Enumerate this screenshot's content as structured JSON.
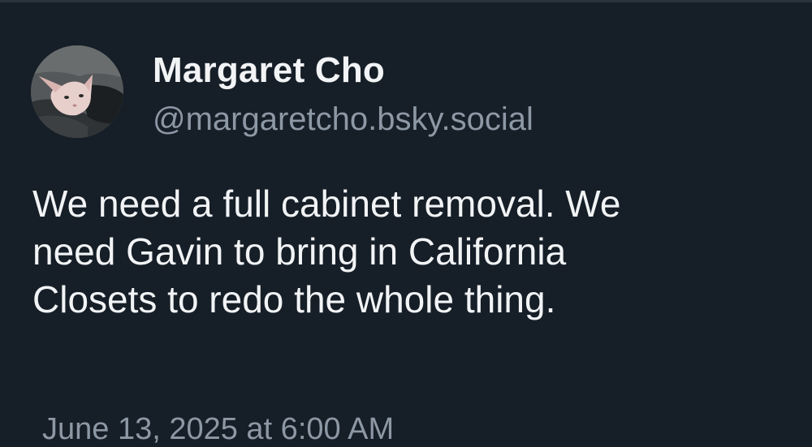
{
  "post": {
    "author": {
      "display_name": "Margaret Cho",
      "handle": "@margaretcho.bsky.social",
      "avatar_icon": "avatar-hairless-cat-photo"
    },
    "text_lines": [
      "We need a full cabinet removal. We",
      "need Gavin to bring in California",
      "Closets to redo the whole thing."
    ],
    "timestamp": "June 13, 2025 at 6:00 AM"
  },
  "colors": {
    "background": "#161e27",
    "primary_text": "#f1f3f5",
    "secondary_text": "#8d98a5"
  }
}
